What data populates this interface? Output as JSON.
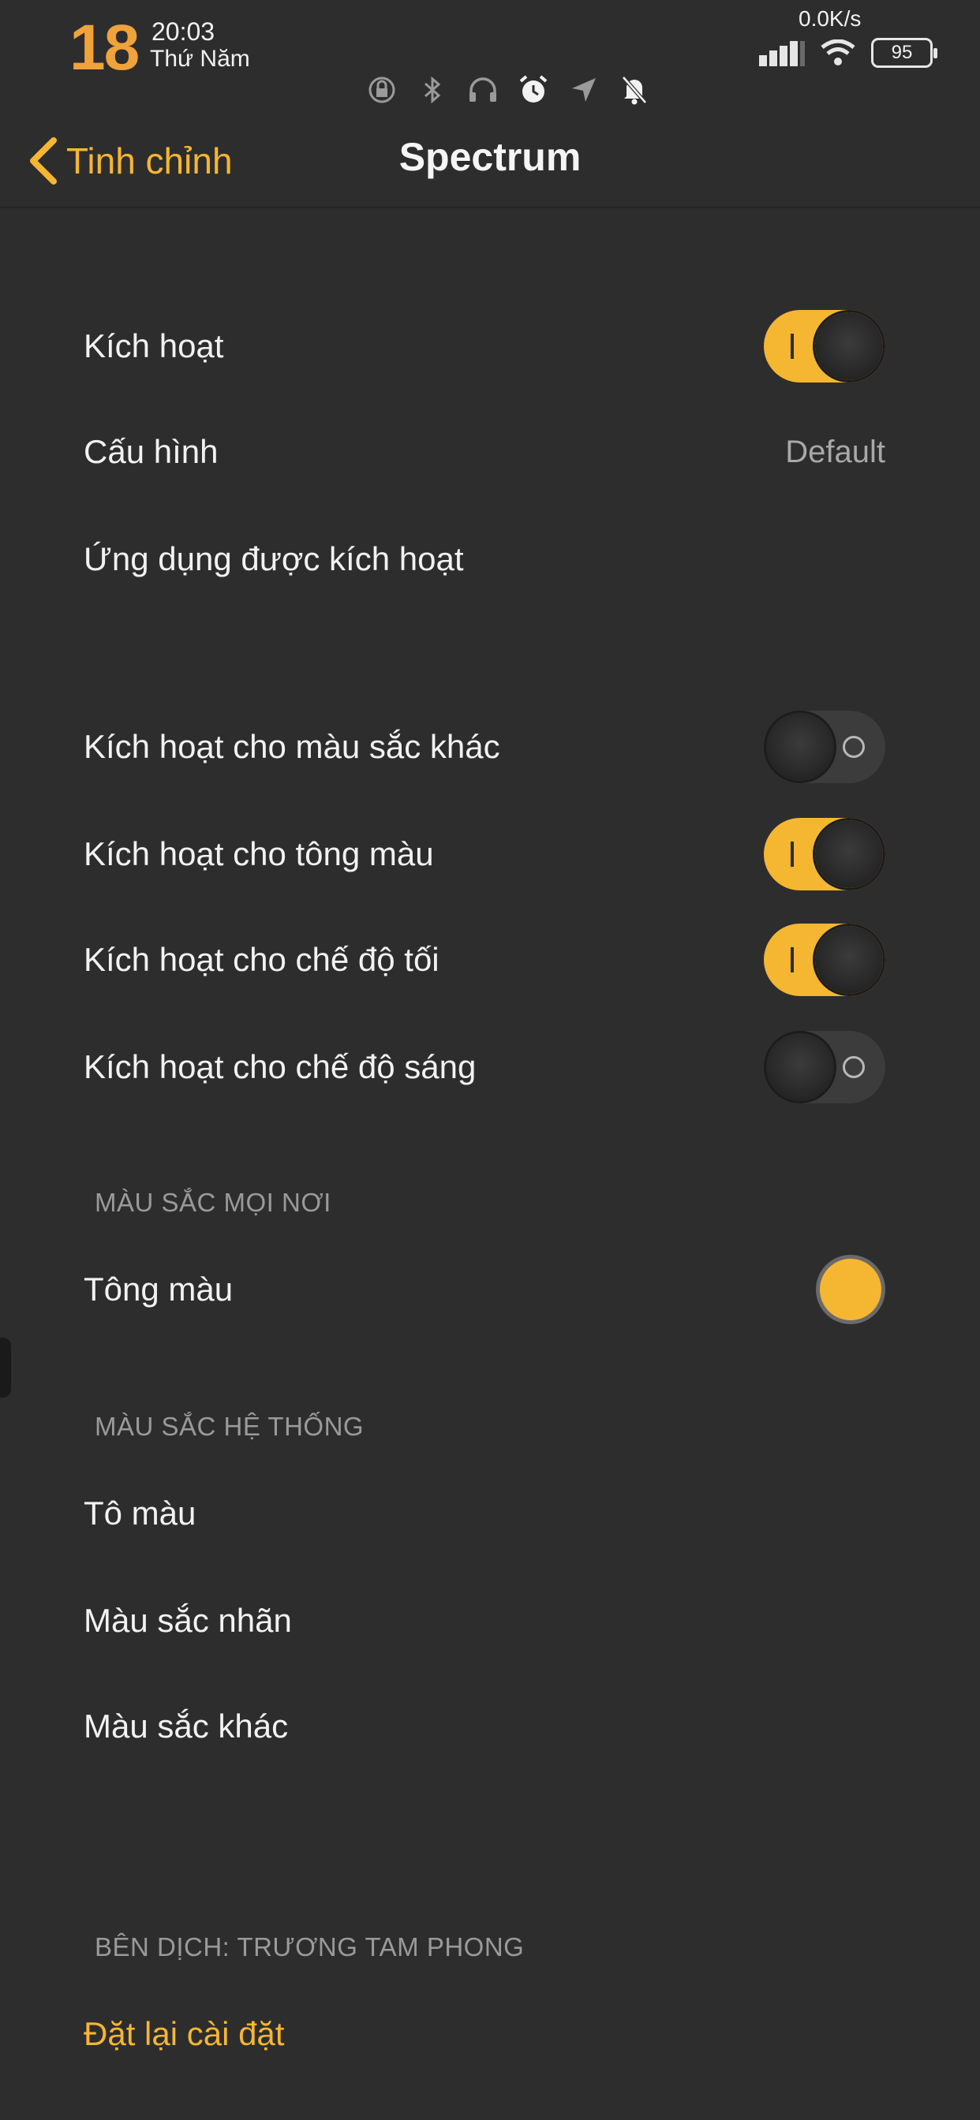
{
  "status_bar": {
    "day": "18",
    "time": "20:03",
    "weekday": "Thứ Năm",
    "net_speed": "0.0K/s",
    "battery": "95",
    "icons": [
      "lock-rotation-icon",
      "bluetooth-icon",
      "headphones-icon",
      "alarm-icon",
      "location-icon",
      "mute-bell-icon",
      "signal-icon",
      "wifi-icon"
    ]
  },
  "header": {
    "back_label": "Tinh chỉnh",
    "title": "Spectrum"
  },
  "rows": {
    "enable": {
      "label": "Kích hoạt",
      "on": true
    },
    "config": {
      "label": "Cấu hình",
      "value": "Default"
    },
    "apps": {
      "label": "Ứng dụng được kích hoạt"
    },
    "other_colors": {
      "label": "Kích hoạt cho màu sắc khác",
      "on": false
    },
    "tone": {
      "label": "Kích hoạt cho tông màu",
      "on": true
    },
    "dark_mode": {
      "label": "Kích hoạt cho chế độ tối",
      "on": true
    },
    "light_mode": {
      "label": "Kích hoạt cho chế độ sáng",
      "on": false
    }
  },
  "section_everywhere": {
    "title": "MÀU SẮC MỌI NƠI",
    "tone_label": "Tông màu",
    "tone_color": "#f5b631"
  },
  "section_system": {
    "title": "MÀU SẮC HỆ THỐNG",
    "items": [
      "Tô màu",
      "Màu sắc nhãn",
      "Màu sắc khác"
    ]
  },
  "section_credit": {
    "title": "BÊN DỊCH: TRƯƠNG TAM PHONG",
    "reset_label": "Đặt lại cài đặt"
  },
  "colors": {
    "accent": "#f5b631",
    "background": "#2d2d2d",
    "day_number": "#f0a23b"
  }
}
